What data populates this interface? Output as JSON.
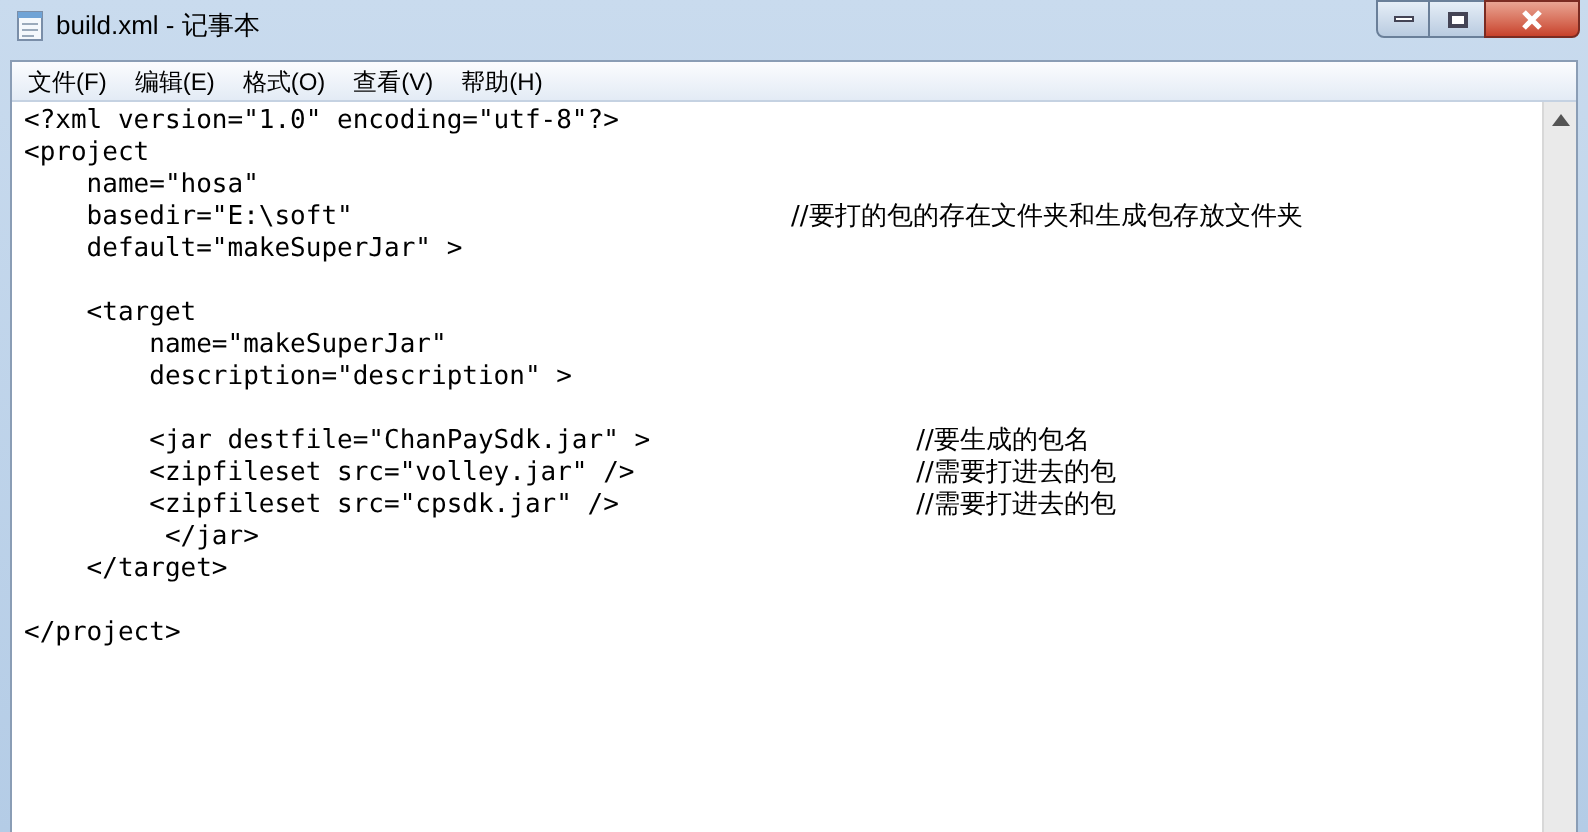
{
  "window": {
    "title": "build.xml - 记事本"
  },
  "menu": [
    {
      "label": "文件(F)"
    },
    {
      "label": "编辑(E)"
    },
    {
      "label": "格式(O)"
    },
    {
      "label": "查看(V)"
    },
    {
      "label": "帮助(H)"
    }
  ],
  "editor": {
    "lines": [
      {
        "kind": "plain",
        "code": "<?xml version=\"1.0\" encoding=\"utf-8\"?>"
      },
      {
        "kind": "plain",
        "code": "<project"
      },
      {
        "kind": "plain",
        "code": "    name=\"hosa\""
      },
      {
        "kind": "project-note",
        "code": "    basedir=\"E:\\soft\"",
        "comment": "//要打的包的存在文件夹和生成包存放文件夹"
      },
      {
        "kind": "plain",
        "code": "    default=\"makeSuperJar\" >"
      },
      {
        "kind": "blank"
      },
      {
        "kind": "plain",
        "code": "    <target"
      },
      {
        "kind": "plain",
        "code": "        name=\"makeSuperJar\""
      },
      {
        "kind": "plain",
        "code": "        description=\"description\" >"
      },
      {
        "kind": "blank"
      },
      {
        "kind": "target-note",
        "code": "        <jar destfile=\"ChanPaySdk.jar\" >",
        "comment": "//要生成的包名"
      },
      {
        "kind": "target-note",
        "code": "        <zipfileset src=\"volley.jar\" />",
        "comment": "//需要打进去的包"
      },
      {
        "kind": "target-note",
        "code": "        <zipfileset src=\"cpsdk.jar\" />",
        "comment": "//需要打进去的包"
      },
      {
        "kind": "plain",
        "code": "         </jar>"
      },
      {
        "kind": "plain",
        "code": "    </target>"
      },
      {
        "kind": "blank"
      },
      {
        "kind": "plain",
        "code": "</project>"
      }
    ]
  }
}
